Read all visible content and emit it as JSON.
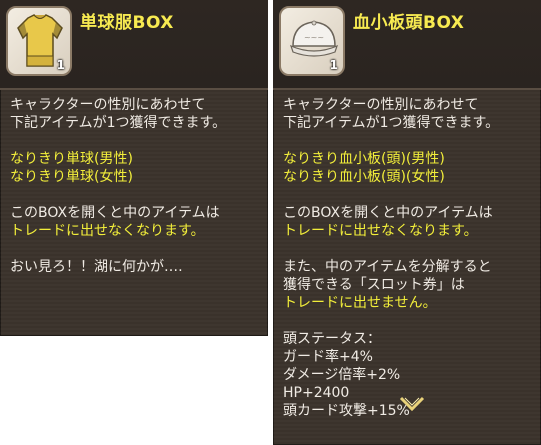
{
  "left": {
    "title": "単球服BOX",
    "count": "1",
    "icon": "yellow-shirt-icon",
    "lines": [
      {
        "text": "キャラクターの性別にあわせて",
        "color": "#f0ebe4"
      },
      {
        "text": "下記アイテムが1つ獲得できます。",
        "color": "#f0ebe4"
      },
      {
        "text": "",
        "color": ""
      },
      {
        "text": "なりきり単球(男性)",
        "color": "#f2ee3a"
      },
      {
        "text": "なりきり単球(女性)",
        "color": "#f2ee3a"
      },
      {
        "text": "",
        "color": ""
      },
      {
        "text": "このBOXを開くと中のアイテムは",
        "color": "#f0ebe4"
      },
      {
        "text": "トレードに出せなくなります。",
        "color": "#f2ee3a"
      },
      {
        "text": "",
        "color": ""
      },
      {
        "text": "おい見ろ！！湖に何かが‥‥",
        "color": "#f0ebe4"
      }
    ]
  },
  "right": {
    "title": "血小板頭BOX",
    "count": "1",
    "icon": "white-cap-icon",
    "lines": [
      {
        "text": "キャラクターの性別にあわせて",
        "color": "#f0ebe4"
      },
      {
        "text": "下記アイテムが1つ獲得できます。",
        "color": "#f0ebe4"
      },
      {
        "text": "",
        "color": ""
      },
      {
        "text": "なりきり血小板(頭)(男性)",
        "color": "#f2ee3a"
      },
      {
        "text": "なりきり血小板(頭)(女性)",
        "color": "#f2ee3a"
      },
      {
        "text": "",
        "color": ""
      },
      {
        "text": "このBOXを開くと中のアイテムは",
        "color": "#f0ebe4"
      },
      {
        "text": "トレードに出せなくなります。",
        "color": "#f2ee3a"
      },
      {
        "text": "",
        "color": ""
      },
      {
        "text": "また、中のアイテムを分解すると",
        "color": "#f0ebe4"
      },
      {
        "text": "獲得できる「スロット券」は",
        "color": "#f0ebe4"
      },
      {
        "text": "トレードに出せません。",
        "color": "#f2ee3a"
      },
      {
        "text": "",
        "color": ""
      },
      {
        "text": "頭ステータス：",
        "color": "#f0ebe4"
      },
      {
        "text": "ガード率+4%",
        "color": "#f0ebe4"
      },
      {
        "text": "ダメージ倍率+2%",
        "color": "#f0ebe4"
      },
      {
        "text": "HP+2400",
        "color": "#f0ebe4"
      },
      {
        "text": "頭カード攻撃+15%",
        "color": "#f0ebe4"
      }
    ],
    "scroll_icon": "chevron-down-icon"
  }
}
